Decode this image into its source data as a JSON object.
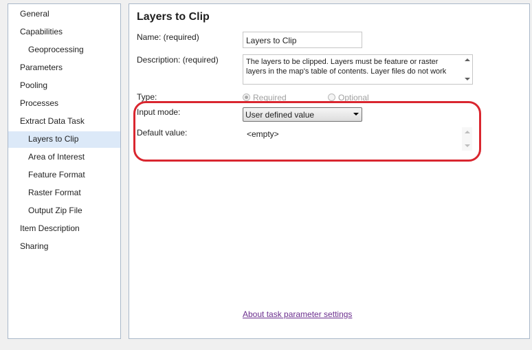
{
  "sidebar": {
    "items": [
      {
        "label": "General",
        "selected": false
      },
      {
        "label": "Capabilities",
        "selected": false
      },
      {
        "label": "Geoprocessing",
        "selected": false
      },
      {
        "label": "Parameters",
        "selected": false
      },
      {
        "label": "Pooling",
        "selected": false
      },
      {
        "label": "Processes",
        "selected": false
      },
      {
        "label": "Extract Data Task",
        "selected": false
      },
      {
        "label": "Layers to Clip",
        "selected": true
      },
      {
        "label": "Area of Interest",
        "selected": false
      },
      {
        "label": "Feature Format",
        "selected": false
      },
      {
        "label": "Raster Format",
        "selected": false
      },
      {
        "label": "Output Zip File",
        "selected": false
      },
      {
        "label": "Item Description",
        "selected": false
      },
      {
        "label": "Sharing",
        "selected": false
      }
    ]
  },
  "main": {
    "title": "Layers to Clip",
    "name": {
      "label": "Name:  (required)",
      "value": "Layers to Clip"
    },
    "description": {
      "label": "Description:  (required)",
      "value": "The layers to be clipped. Layers must be  feature or raster layers in the map's table of contents.  Layer files do not work"
    },
    "type": {
      "label": "Type:",
      "options": [
        {
          "label": "Required",
          "checked": true
        },
        {
          "label": "Optional",
          "checked": false
        }
      ]
    },
    "input_mode": {
      "label": "Input mode:",
      "value": "User defined value"
    },
    "default_value": {
      "label": "Default value:",
      "value": "<empty>"
    },
    "help_link": "About task parameter settings"
  },
  "colors": {
    "highlight": "#d9262f",
    "selection": "#dce9f8",
    "link": "#6b2e8e"
  }
}
